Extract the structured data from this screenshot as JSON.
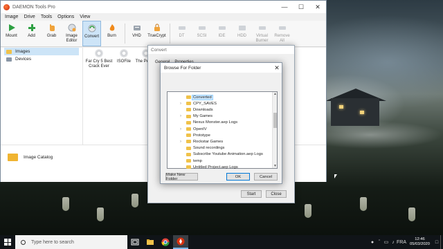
{
  "app": {
    "title": "DAEMON Tools Pro",
    "menu": [
      "Image",
      "Drive",
      "Tools",
      "Options",
      "View"
    ],
    "toolbar": [
      {
        "label": "Mount",
        "icon": "play-icon",
        "state": "normal"
      },
      {
        "label": "Add",
        "icon": "plus-icon",
        "state": "normal"
      },
      {
        "label": "Grab",
        "icon": "hand-icon",
        "state": "normal"
      },
      {
        "label": "Image Editor",
        "icon": "image-editor-icon",
        "state": "normal"
      },
      {
        "label": "Convert",
        "icon": "convert-icon",
        "state": "active"
      },
      {
        "label": "Burn",
        "icon": "flame-icon",
        "state": "normal"
      },
      {
        "label": "VHD",
        "icon": "vhd-icon",
        "state": "normal"
      },
      {
        "label": "TrueCrypt",
        "icon": "truecrypt-icon",
        "state": "normal"
      },
      {
        "label": "DT",
        "icon": "dt-drive-icon",
        "state": "disabled"
      },
      {
        "label": "SCSI",
        "icon": "scsi-drive-icon",
        "state": "disabled"
      },
      {
        "label": "IDE",
        "icon": "ide-drive-icon",
        "state": "disabled"
      },
      {
        "label": "HDD",
        "icon": "hdd-icon",
        "state": "disabled"
      },
      {
        "label": "Virtual Burner",
        "icon": "virtual-burner-icon",
        "state": "disabled"
      },
      {
        "label": "Remove All",
        "icon": "remove-all-icon",
        "state": "disabled"
      }
    ],
    "tree": [
      {
        "label": "Images",
        "selected": true
      },
      {
        "label": "Devices",
        "selected": false
      }
    ],
    "images": [
      {
        "label": "Far Cry 5 Best Crack Ever"
      },
      {
        "label": "ISOFile"
      },
      {
        "label": "The Pedest"
      }
    ],
    "catalog_label": "Image Catalog"
  },
  "convert_dialog": {
    "title": "Convert",
    "tabs": [
      "General",
      "Properties"
    ],
    "start_label": "Start",
    "close_label": "Close"
  },
  "browse_dialog": {
    "title": "Browse For Folder",
    "folders": [
      {
        "label": "Converted",
        "expandable": false,
        "selected": true
      },
      {
        "label": "CPY_SAVES",
        "expandable": true,
        "selected": false
      },
      {
        "label": "Downloads",
        "expandable": false,
        "selected": false
      },
      {
        "label": "My Games",
        "expandable": true,
        "selected": false
      },
      {
        "label": "Nexus Monster.aep Logs",
        "expandable": false,
        "selected": false
      },
      {
        "label": "OpenIV",
        "expandable": true,
        "selected": false
      },
      {
        "label": "Prototype",
        "expandable": false,
        "selected": false
      },
      {
        "label": "Rockstar Games",
        "expandable": true,
        "selected": false
      },
      {
        "label": "Sound recordings",
        "expandable": false,
        "selected": false
      },
      {
        "label": "Subscribe Youtube Animation.aep Logs",
        "expandable": false,
        "selected": false
      },
      {
        "label": "temp",
        "expandable": false,
        "selected": false
      },
      {
        "label": "Untitled Project.aep Logs",
        "expandable": false,
        "selected": false
      }
    ],
    "make_new_folder_label": "Make New Folder",
    "ok_label": "OK",
    "cancel_label": "Cancel"
  },
  "taskbar": {
    "search_placeholder": "Type here to search",
    "language": "FRA",
    "time": "12:46",
    "date": "05/03/2020"
  }
}
